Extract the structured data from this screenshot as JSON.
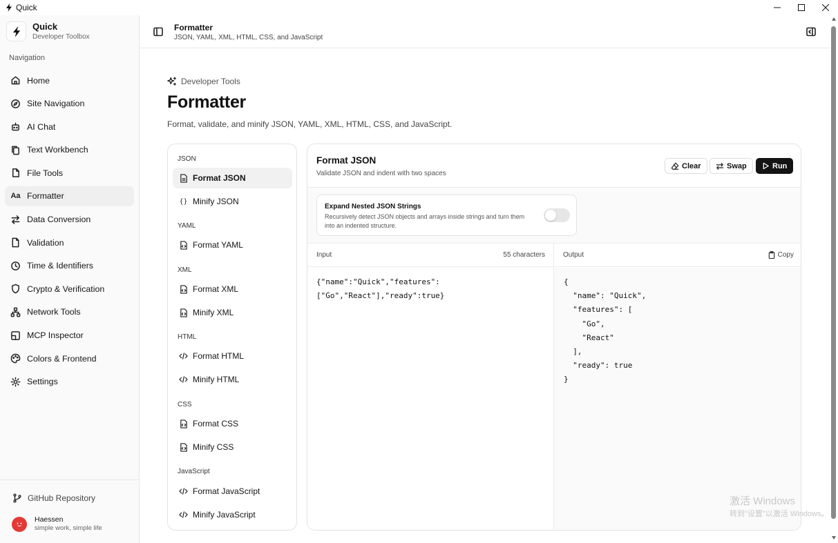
{
  "window": {
    "title": "Quick"
  },
  "brand": {
    "name": "Quick",
    "tagline": "Developer Toolbox"
  },
  "sidebar": {
    "heading": "Navigation",
    "items": [
      {
        "label": "Home",
        "icon": "home-icon"
      },
      {
        "label": "Site Navigation",
        "icon": "compass-icon"
      },
      {
        "label": "AI Chat",
        "icon": "bot-icon"
      },
      {
        "label": "Text Workbench",
        "icon": "copy-doc-icon"
      },
      {
        "label": "File Tools",
        "icon": "folder-icon"
      },
      {
        "label": "Formatter",
        "icon": "font-icon",
        "active": true
      },
      {
        "label": "Data Conversion",
        "icon": "arrows-swap-icon"
      },
      {
        "label": "Validation",
        "icon": "file-check-icon"
      },
      {
        "label": "Time & Identifiers",
        "icon": "clock-icon"
      },
      {
        "label": "Crypto & Verification",
        "icon": "shield-icon"
      },
      {
        "label": "Network Tools",
        "icon": "network-icon"
      },
      {
        "label": "MCP Inspector",
        "icon": "plug-icon"
      },
      {
        "label": "Colors & Frontend",
        "icon": "palette-icon"
      },
      {
        "label": "Settings",
        "icon": "gear-icon"
      }
    ],
    "footer": {
      "github_label": "GitHub Repository",
      "user_name": "Haessen",
      "user_tagline": "simple work, simple life"
    }
  },
  "header": {
    "title": "Formatter",
    "subtitle": "JSON, YAML, XML, HTML, CSS, and JavaScript"
  },
  "page": {
    "crumb": "Developer Tools",
    "title": "Formatter",
    "description": "Format, validate, and minify JSON, YAML, XML, HTML, CSS, and JavaScript."
  },
  "tools": {
    "groups": [
      {
        "label": "JSON",
        "items": [
          {
            "label": "Format JSON",
            "icon": "file-icon",
            "active": true
          },
          {
            "label": "Minify JSON",
            "icon": "braces-icon"
          }
        ]
      },
      {
        "label": "YAML",
        "items": [
          {
            "label": "Format YAML",
            "icon": "file-code-icon"
          }
        ]
      },
      {
        "label": "XML",
        "items": [
          {
            "label": "Format XML",
            "icon": "file-code-icon"
          },
          {
            "label": "Minify XML",
            "icon": "file-code-icon"
          }
        ]
      },
      {
        "label": "HTML",
        "items": [
          {
            "label": "Format HTML",
            "icon": "code-icon"
          },
          {
            "label": "Minify HTML",
            "icon": "code-icon"
          }
        ]
      },
      {
        "label": "CSS",
        "items": [
          {
            "label": "Format CSS",
            "icon": "file-code-icon"
          },
          {
            "label": "Minify CSS",
            "icon": "file-code-icon"
          }
        ]
      },
      {
        "label": "JavaScript",
        "items": [
          {
            "label": "Format JavaScript",
            "icon": "code-icon"
          },
          {
            "label": "Minify JavaScript",
            "icon": "code-icon"
          }
        ]
      }
    ]
  },
  "tool": {
    "title": "Format JSON",
    "subtitle": "Validate JSON and indent with two spaces",
    "buttons": {
      "clear": "Clear",
      "swap": "Swap",
      "run": "Run"
    },
    "option": {
      "title": "Expand Nested JSON Strings",
      "description": "Recursively detect JSON objects and arrays inside strings and turn them into an indented structure.",
      "enabled": false
    },
    "input": {
      "label": "Input",
      "char_count": "55 characters",
      "value": "{\"name\":\"Quick\",\"features\":[\"Go\",\"React\"],\"ready\":true}"
    },
    "output": {
      "label": "Output",
      "copy_label": "Copy",
      "value": "{\n  \"name\": \"Quick\",\n  \"features\": [\n    \"Go\",\n    \"React\"\n  ],\n  \"ready\": true\n}"
    }
  },
  "watermark": {
    "line1": "激活 Windows",
    "line2": "转到\"设置\"以激活 Windows。"
  }
}
